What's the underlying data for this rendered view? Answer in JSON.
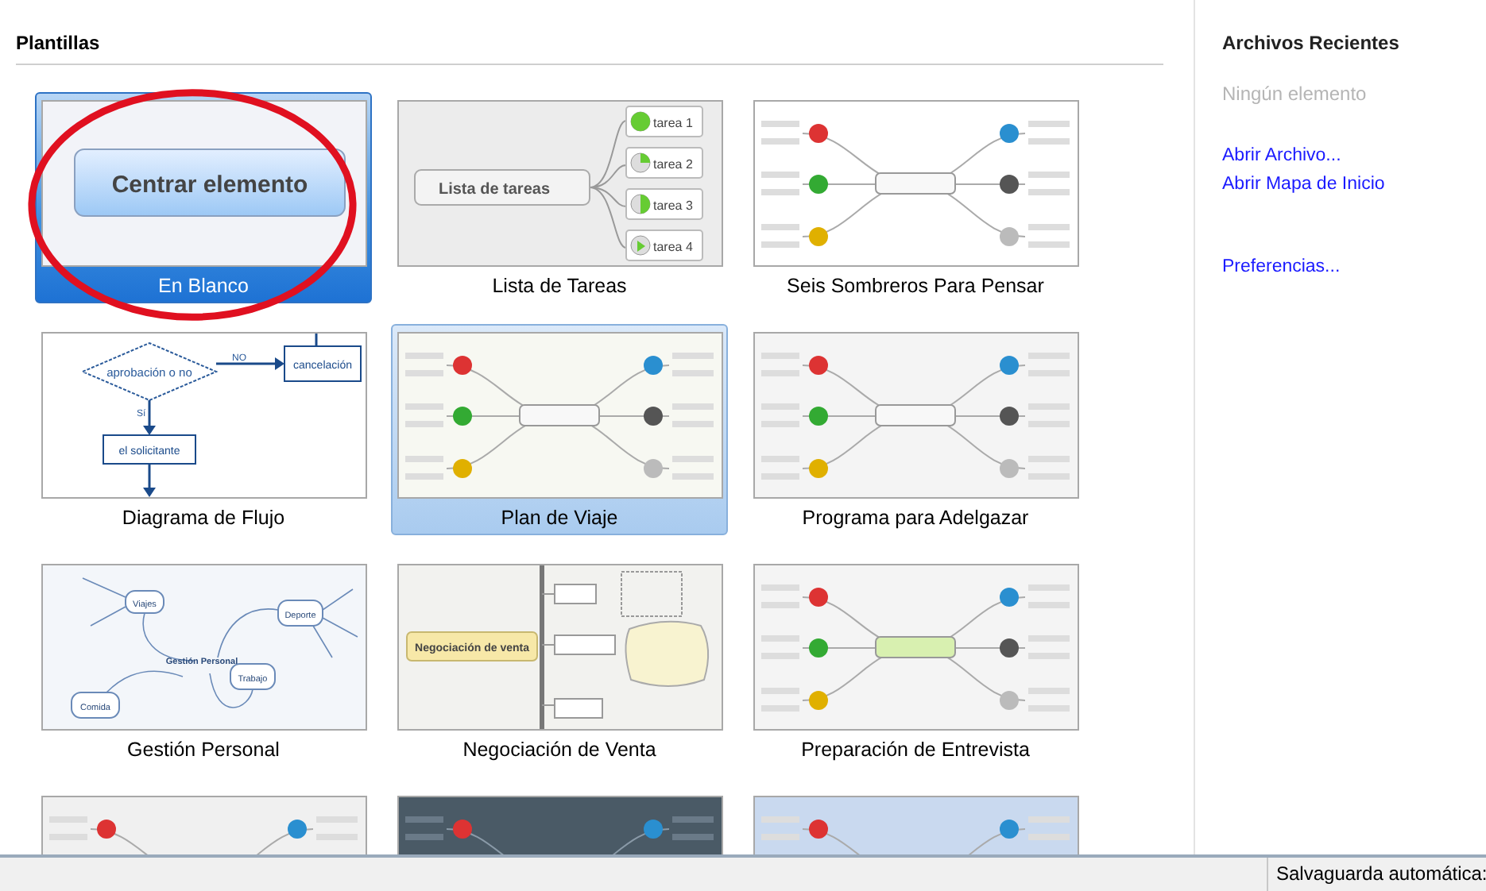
{
  "templates_panel": {
    "title": "Plantillas"
  },
  "templates": [
    {
      "label": "En Blanco",
      "kind": "blank",
      "selected": true,
      "highlighted": false,
      "circled": true,
      "texts": [
        "Centrar elemento"
      ]
    },
    {
      "label": "Lista de Tareas",
      "kind": "tasks",
      "selected": false,
      "highlighted": false,
      "circled": false,
      "texts": [
        "Lista de tareas",
        "tarea 1",
        "tarea 2",
        "tarea 3",
        "tarea 4"
      ]
    },
    {
      "label": "Seis Sombreros Para Pensar",
      "kind": "hats",
      "selected": false,
      "highlighted": false,
      "circled": false
    },
    {
      "label": "Diagrama de Flujo",
      "kind": "flow",
      "selected": false,
      "highlighted": false,
      "circled": false,
      "texts": [
        "aprobación o no",
        "NO",
        "cancelación",
        "Sí",
        "el solicitante"
      ]
    },
    {
      "label": "Plan de Viaje",
      "kind": "travel",
      "selected": false,
      "highlighted": true,
      "circled": false
    },
    {
      "label": "Programa para Adelgazar",
      "kind": "diet",
      "selected": false,
      "highlighted": false,
      "circled": false
    },
    {
      "label": "Gestión Personal",
      "kind": "personal",
      "selected": false,
      "highlighted": false,
      "circled": false,
      "texts": [
        "Gestión Personal",
        "Viajes",
        "Deporte",
        "Trabajo",
        "Comida"
      ]
    },
    {
      "label": "Negociación de Venta",
      "kind": "negotiation",
      "selected": false,
      "highlighted": false,
      "circled": false,
      "texts": [
        "Negociación de venta"
      ]
    },
    {
      "label": "Preparación de Entrevista",
      "kind": "interview",
      "selected": false,
      "highlighted": false,
      "circled": false
    },
    {
      "kind": "marketing",
      "selected": false,
      "highlighted": false,
      "circled": false
    },
    {
      "kind": "dark",
      "selected": false,
      "highlighted": false,
      "circled": false
    },
    {
      "kind": "blueprint",
      "selected": false,
      "highlighted": false,
      "circled": false
    }
  ],
  "recent_files": {
    "title": "Archivos Recientes",
    "empty_text": "Ningún elemento",
    "links": [
      "Abrir Archivo...",
      "Abrir Mapa de Inicio"
    ],
    "preferences": "Preferencias..."
  },
  "status_bar": {
    "autosave": "Salvaguarda automática:"
  }
}
